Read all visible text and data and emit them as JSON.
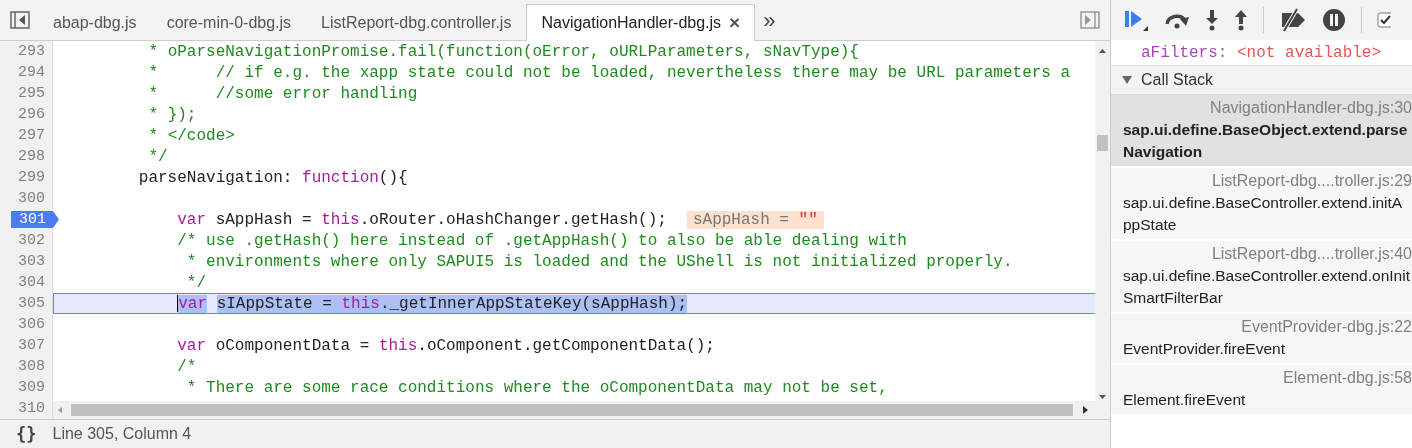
{
  "editor_tabs": [
    {
      "label": "abap-dbg.js",
      "selected": false
    },
    {
      "label": "core-min-0-dbg.js",
      "selected": false
    },
    {
      "label": "ListReport-dbg.controller.js",
      "selected": false
    },
    {
      "label": "NavigationHandler-dbg.js",
      "selected": true,
      "close": "×"
    }
  ],
  "more_tabs": "»",
  "code_lines": [
    {
      "number": "293",
      "breakpoint": false,
      "current": false,
      "tokens": [
        {
          "kind": "comment",
          "text": "         * oParseNavigationPromise.fail(function(oError, oURLParameters, sNavType){"
        }
      ]
    },
    {
      "number": "294",
      "breakpoint": false,
      "current": false,
      "tokens": [
        {
          "kind": "comment",
          "text": "         *      // if e.g. the xapp state could not be loaded, nevertheless there may be URL parameters a"
        }
      ]
    },
    {
      "number": "295",
      "breakpoint": false,
      "current": false,
      "tokens": [
        {
          "kind": "comment",
          "text": "         *      //some error handling"
        }
      ]
    },
    {
      "number": "296",
      "breakpoint": false,
      "current": false,
      "tokens": [
        {
          "kind": "comment",
          "text": "         * });"
        }
      ]
    },
    {
      "number": "297",
      "breakpoint": false,
      "current": false,
      "tokens": [
        {
          "kind": "comment",
          "text": "         * </code>"
        }
      ]
    },
    {
      "number": "298",
      "breakpoint": false,
      "current": false,
      "tokens": [
        {
          "kind": "comment",
          "text": "         */"
        }
      ]
    },
    {
      "number": "299",
      "breakpoint": false,
      "current": false,
      "tokens": [
        {
          "kind": "plain",
          "text": "        parseNavigation: "
        },
        {
          "kind": "keyword",
          "text": "function"
        },
        {
          "kind": "plain",
          "text": "(){"
        }
      ]
    },
    {
      "number": "300",
      "breakpoint": false,
      "current": false
    },
    {
      "number": "301",
      "breakpoint": true,
      "current": false,
      "tokens": [
        {
          "kind": "keyword",
          "text": "            var"
        },
        {
          "kind": "plain",
          "text": " sAppHash = "
        },
        {
          "kind": "keyword",
          "text": "this"
        },
        {
          "kind": "plain",
          "text": ".oRouter.oHashChanger.getHash();"
        }
      ],
      "inline_value": {
        "label": "sAppHash =",
        "value": "\"\""
      }
    },
    {
      "number": "302",
      "breakpoint": false,
      "current": false,
      "tokens": [
        {
          "kind": "comment",
          "text": "            /* use .getHash() here instead of .getAppHash() to also be able dealing with"
        }
      ]
    },
    {
      "number": "303",
      "breakpoint": false,
      "current": false,
      "tokens": [
        {
          "kind": "comment",
          "text": "             * environments where only SAPUI5 is loaded and the UShell is not initialized properly."
        }
      ]
    },
    {
      "number": "304",
      "breakpoint": false,
      "current": false,
      "tokens": [
        {
          "kind": "comment",
          "text": "             */"
        }
      ]
    },
    {
      "number": "305",
      "breakpoint": false,
      "current": true,
      "tokens": [
        {
          "kind": "keyword",
          "text": "            var",
          "selected": true
        },
        {
          "kind": "plain",
          "text": " sIAppState = ",
          "selected": true
        },
        {
          "kind": "keyword",
          "text": "this",
          "selected": true
        },
        {
          "kind": "plain",
          "text": "._getInnerAppStateKey(sAppHash);",
          "selected": true
        }
      ]
    },
    {
      "number": "306",
      "breakpoint": false,
      "current": false
    },
    {
      "number": "307",
      "breakpoint": false,
      "current": false,
      "tokens": [
        {
          "kind": "keyword",
          "text": "            var"
        },
        {
          "kind": "plain",
          "text": " oComponentData = "
        },
        {
          "kind": "keyword",
          "text": "this"
        },
        {
          "kind": "plain",
          "text": ".oComponent.getComponentData();"
        }
      ]
    },
    {
      "number": "308",
      "breakpoint": false,
      "current": false,
      "tokens": [
        {
          "kind": "comment",
          "text": "            /*"
        }
      ]
    },
    {
      "number": "309",
      "breakpoint": false,
      "current": false,
      "tokens": [
        {
          "kind": "comment",
          "text": "             * There are some race conditions where the oComponentData may not be set,"
        }
      ]
    },
    {
      "number": "310",
      "breakpoint": false,
      "current": false
    }
  ],
  "status_bar": {
    "pretty_print": "{}",
    "position": "Line 305, Column 4"
  },
  "debugger_toolbar": {
    "pause_on_caught_checked": true
  },
  "scope_row": {
    "name": "aFilters",
    "separator": ":",
    "value": "<not available>"
  },
  "call_stack": {
    "title": "Call Stack",
    "expanded": true,
    "frames": [
      {
        "location": "NavigationHandler-dbg.js:30",
        "function": "sap.ui.define.BaseObject.extend.parseNavigation",
        "selected": true
      },
      {
        "location": "ListReport-dbg....troller.js:29",
        "function": "sap.ui.define.BaseController.extend.initAppState",
        "selected": false
      },
      {
        "location": "ListReport-dbg....troller.js:40",
        "function": "sap.ui.define.BaseController.extend.onInitSmartFilterBar",
        "selected": false
      },
      {
        "location": "EventProvider-dbg.js:22",
        "function": "EventProvider.fireEvent",
        "selected": false
      },
      {
        "location": "Element-dbg.js:58",
        "function": "Element.fireEvent",
        "selected": false
      }
    ]
  }
}
